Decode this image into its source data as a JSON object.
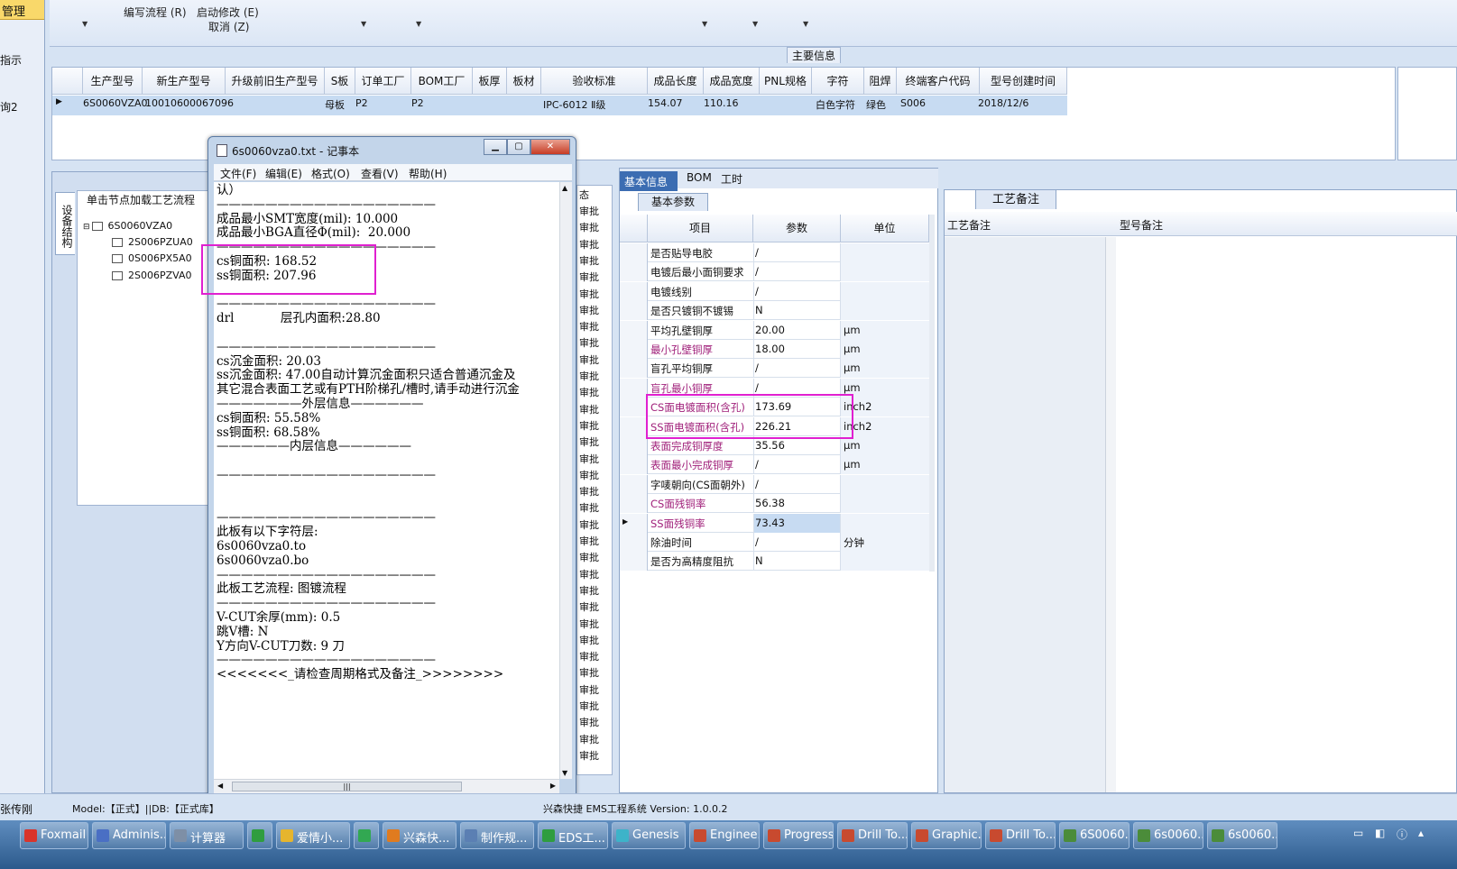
{
  "left_strip": {
    "header": "管理",
    "items": [
      "指示",
      "询2"
    ]
  },
  "ribbon": {
    "buttons": [
      "编写流程 (R)",
      "启动修改 (E)",
      "取消 (Z)"
    ],
    "main_info_label": "主要信息"
  },
  "grid_top": {
    "columns": [
      "生产型号",
      "新生产型号",
      "升级前旧生产型号",
      "S板",
      "订单工厂",
      "BOM工厂",
      "板厚",
      "板材",
      "验收标准",
      "成品长度",
      "成品宽度",
      "PNL规格",
      "字符",
      "阻焊",
      "终端客户代码",
      "型号创建时间"
    ],
    "row": [
      "6S0060VZA0",
      "10010600067096",
      "",
      "母板",
      "P2",
      "P2",
      "",
      "",
      "IPC-6012 Ⅱ级",
      "154.07",
      "110.16",
      "",
      "白色字符",
      "绿色",
      "S006",
      "2018/12/6"
    ]
  },
  "tree": {
    "vertical_tab": "设备结构",
    "title": "单击节点加载工艺流程",
    "root": "6S0060VZA0",
    "children": [
      "2S006PZUA0",
      "0S006PX5A0",
      "2S006PZVA0"
    ]
  },
  "notepad": {
    "title": "6s0060vza0.txt - 记事本",
    "menu": [
      "文件(F)",
      "编辑(E)",
      "格式(O)",
      "查看(V)",
      "帮助(H)"
    ],
    "lines": [
      "认）",
      "——————————————————",
      "成品最小SMT宽度(mil): 10.000",
      "成品最小BGA直径Φ(mil):  20.000",
      "——————————————————",
      "cs铜面积: 168.52",
      "ss铜面积: 207.96",
      "",
      "——————————————————",
      "drl            层孔内面积:28.80",
      "",
      "——————————————————",
      "cs沉金面积: 20.03",
      "ss沉金面积: 47.00自动计算沉金面积只适合普通沉金及",
      "其它混合表面工艺或有PTH阶梯孔/槽时,请手动进行沉金",
      "———————外层信息——————",
      "cs铜面积: 55.58%",
      "ss铜面积: 68.58%",
      "——————内层信息——————",
      "",
      "——————————————————",
      "",
      "",
      "——————————————————",
      "此板有以下字符层:",
      "6s0060vza0.to",
      "6s0060vza0.bo",
      "——————————————————",
      "此板工艺流程: 图镀流程",
      "——————————————————",
      "V-CUT余厚(mm): 0.5",
      "跳V槽: N",
      "Y方向V-CUT刀数: 9 刀",
      "——————————————————",
      "<<<<<<<_请检查周期格式及备注_>>>>>>>>"
    ]
  },
  "status_col": {
    "header": "态",
    "cell": "审批"
  },
  "basic_panel": {
    "tabs": [
      "基本信息",
      "BOM",
      "工时"
    ],
    "subtab": "基本参数",
    "columns": [
      "项目",
      "参数",
      "单位"
    ],
    "rows": [
      {
        "item": "是否贴导电胶",
        "value": "/",
        "unit": "",
        "highlight": false
      },
      {
        "item": "电镀后最小面铜要求",
        "value": "/",
        "unit": "",
        "highlight": false
      },
      {
        "item": "电镀线别",
        "value": "/",
        "unit": "",
        "highlight": false
      },
      {
        "item": "是否只镀铜不镀锡",
        "value": "N",
        "unit": "",
        "highlight": false
      },
      {
        "item": "平均孔壁铜厚",
        "value": "20.00",
        "unit": "μm",
        "highlight": false
      },
      {
        "item": "最小孔壁铜厚",
        "value": "18.00",
        "unit": "μm",
        "highlight": true
      },
      {
        "item": "盲孔平均铜厚",
        "value": "/",
        "unit": "μm",
        "highlight": false
      },
      {
        "item": "盲孔最小铜厚",
        "value": "/",
        "unit": "μm",
        "highlight": true
      },
      {
        "item": "CS面电镀面积(含孔)",
        "value": "173.69",
        "unit": "inch2",
        "highlight": true
      },
      {
        "item": "SS面电镀面积(含孔)",
        "value": "226.21",
        "unit": "inch2",
        "highlight": true
      },
      {
        "item": "表面完成铜厚度",
        "value": "35.56",
        "unit": "μm",
        "highlight": true
      },
      {
        "item": "表面最小完成铜厚",
        "value": "/",
        "unit": "μm",
        "highlight": true
      },
      {
        "item": "字唛朝向(CS面朝外)",
        "value": "/",
        "unit": "",
        "highlight": false
      },
      {
        "item": "CS面残铜率",
        "value": "56.38",
        "unit": "",
        "highlight": true
      },
      {
        "item": "SS面残铜率",
        "value": "73.43",
        "unit": "",
        "highlight": true
      },
      {
        "item": "除油时间",
        "value": "/",
        "unit": "分钟",
        "highlight": false
      },
      {
        "item": "是否为高精度阻抗",
        "value": "N",
        "unit": "",
        "highlight": false
      }
    ]
  },
  "craft_panel": {
    "tab": "工艺备注",
    "col_left": "工艺备注",
    "col_right": "型号备注"
  },
  "statusbar": {
    "user": "张传刚",
    "model": "Model:【正式】||DB:【正式库】",
    "system": "兴森快捷  EMS工程系统  Version: 1.0.0.2"
  },
  "taskbar": [
    {
      "label": "Foxmail",
      "color": "#d9342b"
    },
    {
      "label": "Adminis...",
      "color": "#4a6fc4"
    },
    {
      "label": "计算器",
      "color": "#7e8fa6"
    },
    {
      "label": "",
      "color": "#2f9d3f"
    },
    {
      "label": "爱情小...",
      "color": "#e6b52e"
    },
    {
      "label": "",
      "color": "#32a852"
    },
    {
      "label": "兴森快...",
      "color": "#e07b1f"
    },
    {
      "label": "制作规...",
      "color": "#5b7fb3"
    },
    {
      "label": "EDS工...",
      "color": "#2f9d3f"
    },
    {
      "label": "Genesis",
      "color": "#3db3c9"
    },
    {
      "label": "Enginee...",
      "color": "#c84a2f"
    },
    {
      "label": "Progress",
      "color": "#c84a2f"
    },
    {
      "label": "Drill To...",
      "color": "#c84a2f"
    },
    {
      "label": "Graphic...",
      "color": "#c84a2f"
    },
    {
      "label": "Drill To...",
      "color": "#c84a2f"
    },
    {
      "label": "6S0060...",
      "color": "#4b8c3a"
    },
    {
      "label": "6s0060...",
      "color": "#4b8c3a"
    },
    {
      "label": "6s0060...",
      "color": "#4b8c3a"
    }
  ]
}
